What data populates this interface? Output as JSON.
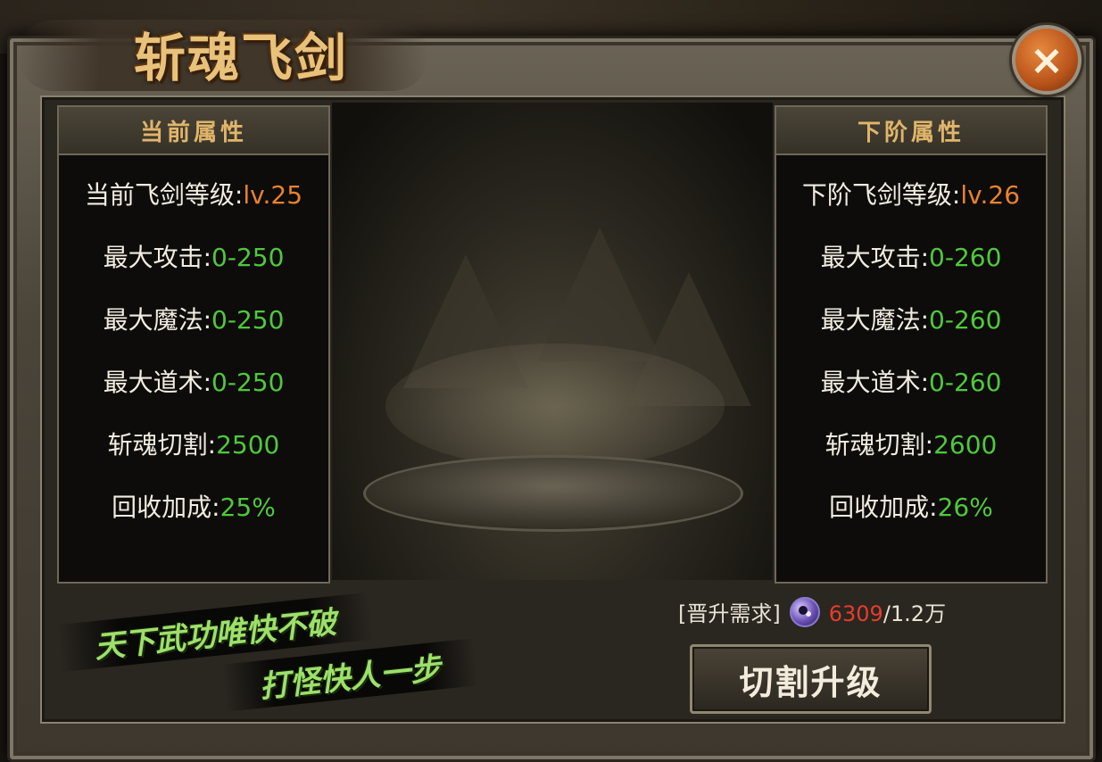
{
  "title": "斩魂飞剑",
  "left_panel": {
    "header": "当前属性",
    "rows": [
      {
        "label": "当前飞剑等级:",
        "value": "lv.25"
      },
      {
        "label": "最大攻击:",
        "value": "0-250"
      },
      {
        "label": "最大魔法:",
        "value": "0-250"
      },
      {
        "label": "最大道术:",
        "value": "0-250"
      },
      {
        "label": "斩魂切割:",
        "value": "2500"
      },
      {
        "label": "回收加成:",
        "value": "25%"
      }
    ]
  },
  "right_panel": {
    "header": "下阶属性",
    "rows": [
      {
        "label": "下阶飞剑等级:",
        "value": "lv.26"
      },
      {
        "label": "最大攻击:",
        "value": "0-260"
      },
      {
        "label": "最大魔法:",
        "value": "0-260"
      },
      {
        "label": "最大道术:",
        "value": "0-260"
      },
      {
        "label": "斩魂切割:",
        "value": "2600"
      },
      {
        "label": "回收加成:",
        "value": "26%"
      }
    ]
  },
  "slogans": [
    "天下武功唯快不破",
    "打怪快人一步"
  ],
  "requirement": {
    "label": "[晋升需求]",
    "icon": "yin-yang-orb-icon",
    "have": "6309",
    "need": "/1.2万"
  },
  "upgrade_button": "切割升级",
  "close_icon": "×",
  "colors": {
    "green_value": "#4fc83c",
    "orange_value": "#e8822e",
    "red_have": "#e83c2c",
    "header_gold": "#e0b56a"
  }
}
